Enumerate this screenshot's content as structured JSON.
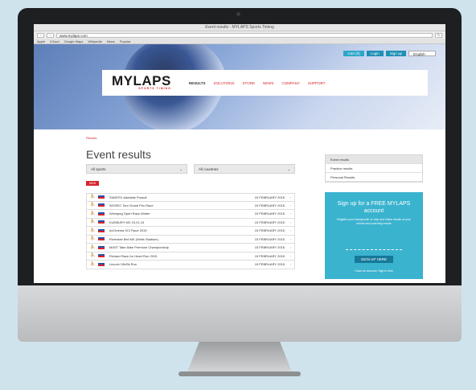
{
  "browser": {
    "title": "Event results - MYLAPS Sports Timing",
    "url": "www.mylaps.com",
    "bookmarks": [
      "Apple",
      "iCloud",
      "Google Maps",
      "Wikipedia",
      "News",
      "Popular"
    ]
  },
  "topbar": {
    "cart": "Cart (0)",
    "login": "Login",
    "signup": "Sign up",
    "language": "English"
  },
  "logo": {
    "main": "MYLAPS",
    "tagline": "SPORTS TIMING"
  },
  "nav": [
    "RESULTS",
    "SOLUTIONS",
    "STORE",
    "NEWS",
    "COMPANY",
    "SUPPORT"
  ],
  "breadcrumb": "Results",
  "page_title": "Event results",
  "filters": {
    "sport": "All sports",
    "country": "All countries"
  },
  "new_tag": "NEW",
  "events": [
    {
      "name": "SWATEX Adelaide Pursuit",
      "date": "15 FEBRUARY 2015"
    },
    {
      "name": "WOSEC Tour Grand Prix Race",
      "date": "15 FEBRUARY 2015"
    },
    {
      "name": "Winnipeg Open Race Winter",
      "date": "15 FEBRUARY 2015"
    },
    {
      "name": "KUDBURY MX 15.01.15",
      "date": "15 FEBRUARY 2015"
    },
    {
      "name": "AvCinema SCI Race 2015",
      "date": "15 FEBRUARY 2015"
    },
    {
      "name": "Riverside Bell MX (Wells Stadium)",
      "date": "15 FEBRUARY 2015"
    },
    {
      "name": "MAST Take Alike Premium Championship",
      "date": "15 FEBRUARY 2015"
    },
    {
      "name": "Richard Race for Heart Run 2015",
      "date": "15 FEBRUARY 2015"
    },
    {
      "name": "Lincoln 10k/5k Run",
      "date": "15 FEBRUARY 2015"
    }
  ],
  "sidebar": {
    "header": "Event results",
    "items": [
      "Practice results",
      "Personal Results"
    ]
  },
  "promo": {
    "title": "Sign up for a FREE MYLAPS account",
    "text": "Register your transponder or chip and follow results of your events and coaching results",
    "button": "SIGN UP HERE",
    "footer": "I have an account. Sign in here"
  },
  "colors": {
    "brand_red": "#d8232a",
    "accent_blue": "#3ab3cf"
  }
}
